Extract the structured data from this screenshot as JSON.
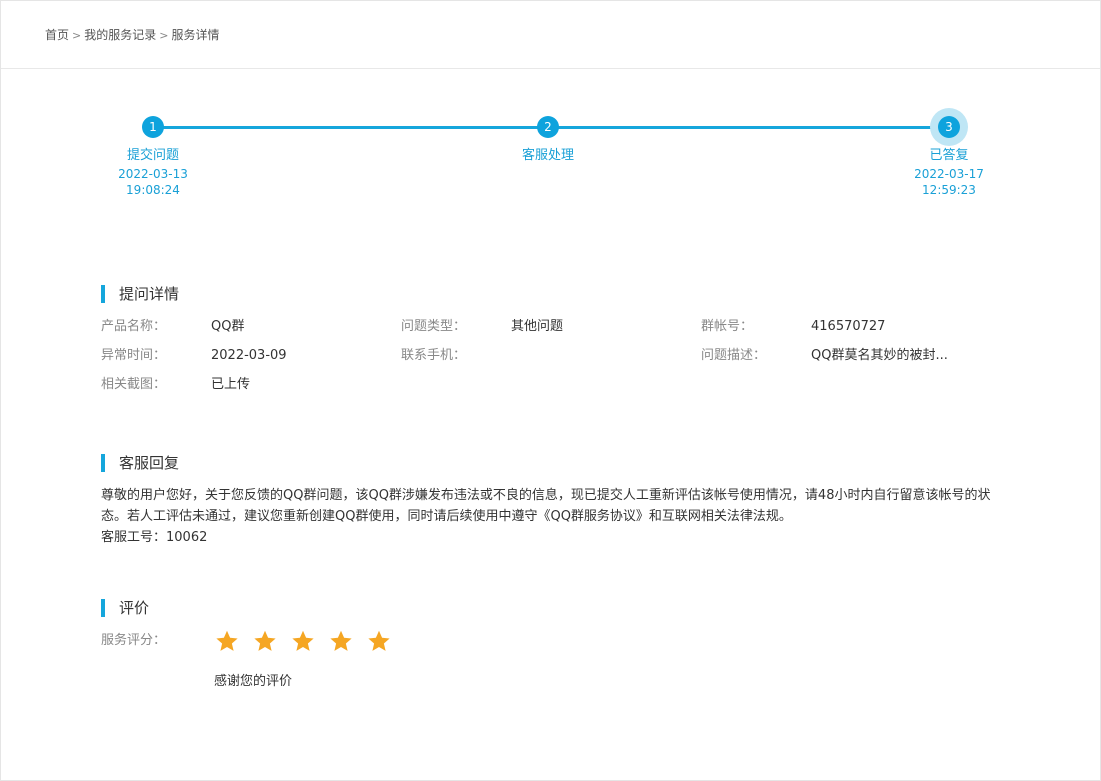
{
  "breadcrumb": {
    "home": "首页",
    "records": "我的服务记录",
    "current": "服务详情",
    "separator": ">"
  },
  "steps": [
    {
      "number": "1",
      "label": "提交问题",
      "date": "2022-03-13",
      "time": "19:08:24"
    },
    {
      "number": "2",
      "label": "客服处理",
      "date": "",
      "time": ""
    },
    {
      "number": "3",
      "label": "已答复",
      "date": "2022-03-17",
      "time": "12:59:23"
    }
  ],
  "question_details": {
    "title": "提问详情",
    "fields": [
      {
        "label": "产品名称：",
        "value": "QQ群"
      },
      {
        "label": "问题类型：",
        "value": "其他问题"
      },
      {
        "label": "群帐号：",
        "value": "416570727"
      },
      {
        "label": "异常时间：",
        "value": "2022-03-09"
      },
      {
        "label": "联系手机：",
        "value": ""
      },
      {
        "label": "问题描述：",
        "value": "QQ群莫名其妙的被封..."
      },
      {
        "label": "相关截图：",
        "value": "已上传"
      }
    ]
  },
  "reply": {
    "title": "客服回复",
    "text": " 尊敬的用户您好，关于您反馈的QQ群问题，该QQ群涉嫌发布违法或不良的信息，现已提交人工重新评估该帐号使用情况，请48小时内自行留意该帐号的状态。若人工评估未通过，建议您重新创建QQ群使用，同时请后续使用中遵守《QQ群服务协议》和互联网相关法律法规。",
    "agent": "客服工号：10062"
  },
  "rating": {
    "title": "评价",
    "label": "服务评分：",
    "stars": 5,
    "max_stars": 5,
    "thanks": "感谢您的评价"
  },
  "colors": {
    "accent": "#15a6dc",
    "star": "#f5a623"
  }
}
